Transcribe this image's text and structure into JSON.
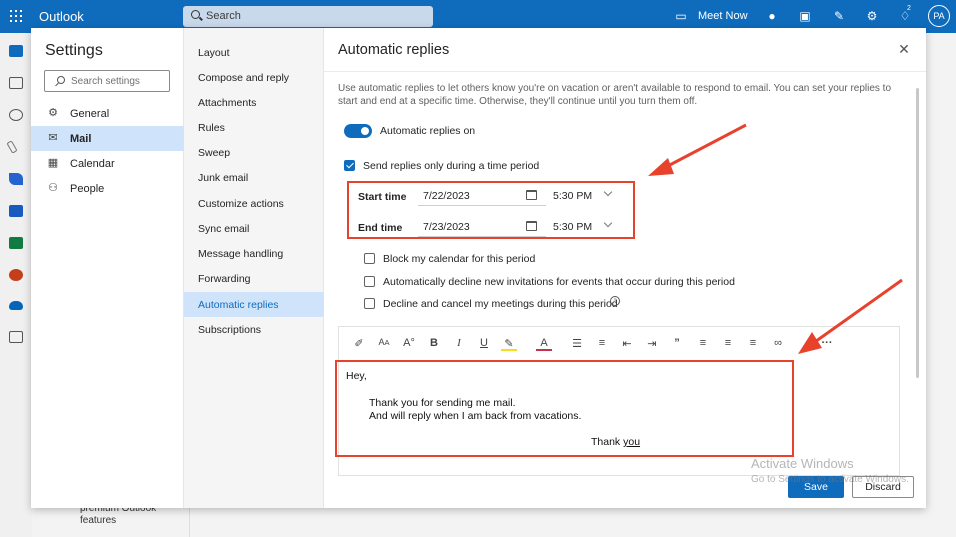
{
  "topbar": {
    "app_name": "Outlook",
    "search_placeholder": "Search",
    "meet_now": "Meet Now",
    "badge_count": "2",
    "avatar_initials": "PA"
  },
  "background": {
    "premium_text": "premium Outlook features"
  },
  "settings": {
    "title": "Settings",
    "search_placeholder": "Search settings",
    "categories": [
      {
        "label": "General",
        "icon": "gear-icon"
      },
      {
        "label": "Mail",
        "icon": "mail-icon"
      },
      {
        "label": "Calendar",
        "icon": "calendar-icon"
      },
      {
        "label": "People",
        "icon": "people-icon"
      }
    ],
    "mail_sections": [
      "Layout",
      "Compose and reply",
      "Attachments",
      "Rules",
      "Sweep",
      "Junk email",
      "Customize actions",
      "Sync email",
      "Message handling",
      "Forwarding",
      "Automatic replies",
      "Subscriptions"
    ]
  },
  "pane": {
    "title": "Automatic replies",
    "description": "Use automatic replies to let others know you're on vacation or aren't available to respond to email. You can set your replies to start and end at a specific time. Otherwise, they'll continue until you turn them off.",
    "toggle_label": "Automatic replies on",
    "time_period_label": "Send replies only during a time period",
    "start_label": "Start time",
    "start_date": "7/22/2023",
    "start_time": "5:30 PM",
    "end_label": "End time",
    "end_date": "7/23/2023",
    "end_time": "5:30 PM",
    "option_block_calendar": "Block my calendar for this period",
    "option_decline_invites": "Automatically decline new invitations for events that occur during this period",
    "option_cancel_meetings": "Decline and cancel my meetings during this period",
    "toolbar_overflow": "···",
    "message": {
      "greeting": "Hey,",
      "line1": "Thank you for sending me mail.",
      "line2": "And will reply when I am back from vacations.",
      "closing_thank": "Thank",
      "closing_you": "you"
    },
    "save": "Save",
    "discard": "Discard"
  },
  "watermark": {
    "title": "Activate Windows",
    "subtitle": "Go to Settings to activate Windows."
  },
  "colors": {
    "brand": "#0f6cbd",
    "selected": "#cfe4fa",
    "annotation": "#e8412c"
  }
}
